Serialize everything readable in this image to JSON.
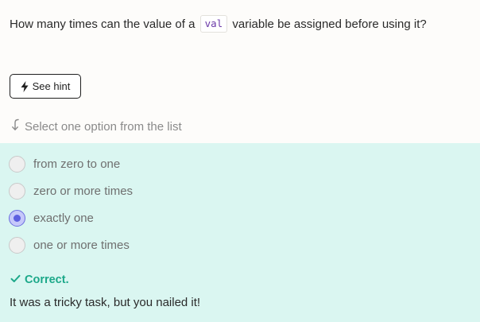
{
  "question": {
    "before": "How many times can the value of a",
    "code": "val",
    "after": "variable be assigned before using it?"
  },
  "hint_button": {
    "label": "See hint",
    "icon": "lightning-bolt-icon"
  },
  "instruction": {
    "label": "Select one option from the list",
    "icon": "arrow-down-left-icon"
  },
  "options": [
    {
      "label": "from zero to one",
      "selected": false
    },
    {
      "label": "zero or more times",
      "selected": false
    },
    {
      "label": "exactly one",
      "selected": true
    },
    {
      "label": "one or more times",
      "selected": false
    }
  ],
  "result": {
    "status": "Correct.",
    "icon": "checkmark-icon",
    "color": "#1ca889"
  },
  "feedback": "It was a tricky task, but you nailed it!",
  "colors": {
    "panel_background": "#daf6f1",
    "selected_radio": "#5d5fe0",
    "code_text": "#6b3aa8"
  }
}
